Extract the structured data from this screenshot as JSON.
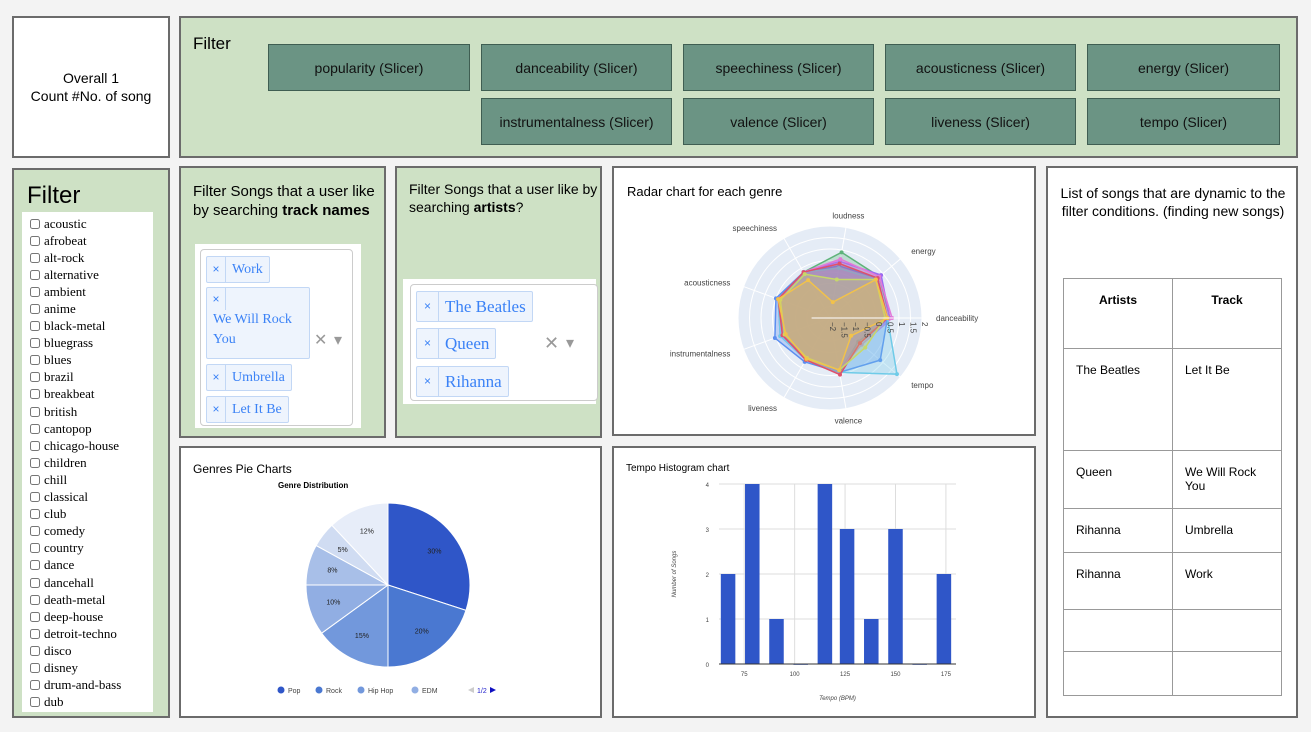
{
  "overall": {
    "line1": "Overall 1",
    "line2": "Count #No. of song"
  },
  "top_filter": {
    "title": "Filter",
    "slicers": [
      "popularity (Slicer)",
      "danceability (Slicer)",
      "speechiness (Slicer)",
      "acousticness (Slicer)",
      "energy (Slicer)",
      "instrumentalness (Slicer)",
      "valence (Slicer)",
      "liveness (Slicer)",
      "tempo (Slicer)"
    ],
    "slicer_color": "#6b9484"
  },
  "genre_filter": {
    "title": "Filter",
    "genres": [
      "acoustic",
      "afrobeat",
      "alt-rock",
      "alternative",
      "ambient",
      "anime",
      "black-metal",
      "bluegrass",
      "blues",
      "brazil",
      "breakbeat",
      "british",
      "cantopop",
      "chicago-house",
      "children",
      "chill",
      "classical",
      "club",
      "comedy",
      "country",
      "dance",
      "dancehall",
      "death-metal",
      "deep-house",
      "detroit-techno",
      "disco",
      "disney",
      "drum-and-bass",
      "dub"
    ]
  },
  "track_search": {
    "title_plain": "Filter Songs that a user like by searching ",
    "title_bold": "track names",
    "tags": [
      "Work",
      "We Will Rock You",
      "Umbrella",
      "Let It Be"
    ],
    "remove_glyph": "×",
    "clear_glyph": "✕",
    "dropdown_glyph": "▾"
  },
  "artist_search": {
    "title_plain": "Filter Songs that a user like by searching ",
    "title_bold": "artists",
    "title_suffix": "?",
    "tags": [
      "The Beatles",
      "Queen",
      "Rihanna"
    ]
  },
  "song_list": {
    "title": "List of songs that are dynamic to the filter conditions. (finding new songs)",
    "headers": [
      "Artists",
      "Track"
    ],
    "rows": [
      [
        "The Beatles",
        "Let It Be"
      ],
      [
        "Queen",
        "We Will Rock You"
      ],
      [
        "Rihanna",
        "Umbrella"
      ],
      [
        "Rihanna",
        "Work"
      ],
      [
        "",
        ""
      ],
      [
        "",
        ""
      ]
    ]
  },
  "chart_data": [
    {
      "type": "radar",
      "title": "Radar chart for each genre",
      "axes": [
        "danceability",
        "energy",
        "loudness",
        "speechiness",
        "acousticness",
        "instrumentalness",
        "liveness",
        "valence",
        "tempo"
      ],
      "radial_range": [
        -2,
        2
      ],
      "radial_ticks": [
        "−2",
        "−1.5",
        "−1",
        "−0.5",
        "0",
        "0.5",
        "1",
        "1.5",
        "2"
      ],
      "series": [
        {
          "color": "#5fb37a",
          "values": [
            0.6,
            0.8,
            0.9,
            0.3,
            0.4,
            0.1,
            0.1,
            0.4,
            -0.4
          ]
        },
        {
          "color": "#9b6bf0",
          "values": [
            0.6,
            0.9,
            0.5,
            0.3,
            0.4,
            0.3,
            0.1,
            0.3,
            -0.3
          ]
        },
        {
          "color": "#e27ad8",
          "values": [
            0.7,
            0.8,
            0.6,
            0.3,
            0.4,
            0.2,
            0.1,
            0.3,
            -0.2
          ]
        },
        {
          "color": "#5c8ef0",
          "values": [
            0.5,
            0.7,
            0.3,
            0.3,
            0.5,
            0.55,
            0.2,
            0.4,
            0.85
          ]
        },
        {
          "color": "#6fcbe8",
          "values": [
            0.5,
            0.6,
            0.2,
            0.3,
            0.4,
            0.3,
            0.1,
            0.4,
            1.8
          ]
        },
        {
          "color": "#e0506a",
          "values": [
            0.5,
            0.7,
            0.4,
            0.3,
            0.4,
            0.2,
            0.1,
            0.5,
            -0.3
          ]
        },
        {
          "color": "#c6d86a",
          "values": [
            0.4,
            0.6,
            -0.3,
            0.2,
            0.3,
            0.1,
            0.0,
            0.3,
            0.0
          ]
        },
        {
          "color": "#f2c24a",
          "values": [
            0.5,
            0.6,
            -1.3,
            -0.1,
            0.4,
            0.05,
            0.05,
            0.3,
            -0.8
          ]
        }
      ]
    },
    {
      "type": "pie",
      "panel_title": "Genres Pie Charts",
      "title": "Genre Distribution",
      "values": [
        30,
        20,
        15,
        10,
        8,
        5,
        12
      ],
      "labels": [
        "30%",
        "20%",
        "15%",
        "10%",
        "8%",
        "5%",
        "12%"
      ],
      "colors": [
        "#2f56c8",
        "#4a78d1",
        "#7298dc",
        "#91aee3",
        "#a8bfe8",
        "#d0dcf2",
        "#e7edf9"
      ],
      "legend": [
        "Pop",
        "Rock",
        "Hip Hop",
        "EDM"
      ],
      "legend_page": "1/2",
      "legend_position": "bottom"
    },
    {
      "type": "bar",
      "title": "Tempo Histogram chart",
      "xlabel": "Tempo (BPM)",
      "ylabel": "Number of Songs",
      "x": [
        67,
        79,
        91,
        103,
        115,
        126,
        138,
        150,
        162,
        174
      ],
      "values": [
        2,
        4,
        1,
        0,
        4,
        3,
        1,
        3,
        0,
        2
      ],
      "xlim": [
        62.5,
        180
      ],
      "ylim": [
        0,
        4
      ],
      "xticks": [
        75,
        100,
        125,
        150,
        175
      ],
      "yticks": [
        0,
        1,
        2,
        3,
        4
      ],
      "color": "#2f56c8",
      "grid": true
    }
  ]
}
